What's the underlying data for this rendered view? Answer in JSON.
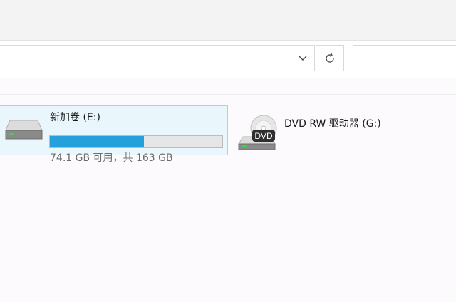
{
  "address_bar": {
    "value": ""
  },
  "search": {
    "placeholder": ""
  },
  "drives": [
    {
      "name": "新加卷 (E:)",
      "size_text": "74.1 GB 可用，共 163 GB",
      "used_fraction": 0.546
    },
    {
      "name": "DVD RW 驱动器 (G:)",
      "badge": "DVD"
    }
  ],
  "icons": {
    "dropdown": "chevron-down-icon",
    "refresh": "refresh-icon",
    "hard_drive": "hard-drive-icon",
    "dvd": "dvd-drive-icon"
  },
  "colors": {
    "usage_fill": "#26a0da",
    "selection_border": "#99d9ea"
  }
}
